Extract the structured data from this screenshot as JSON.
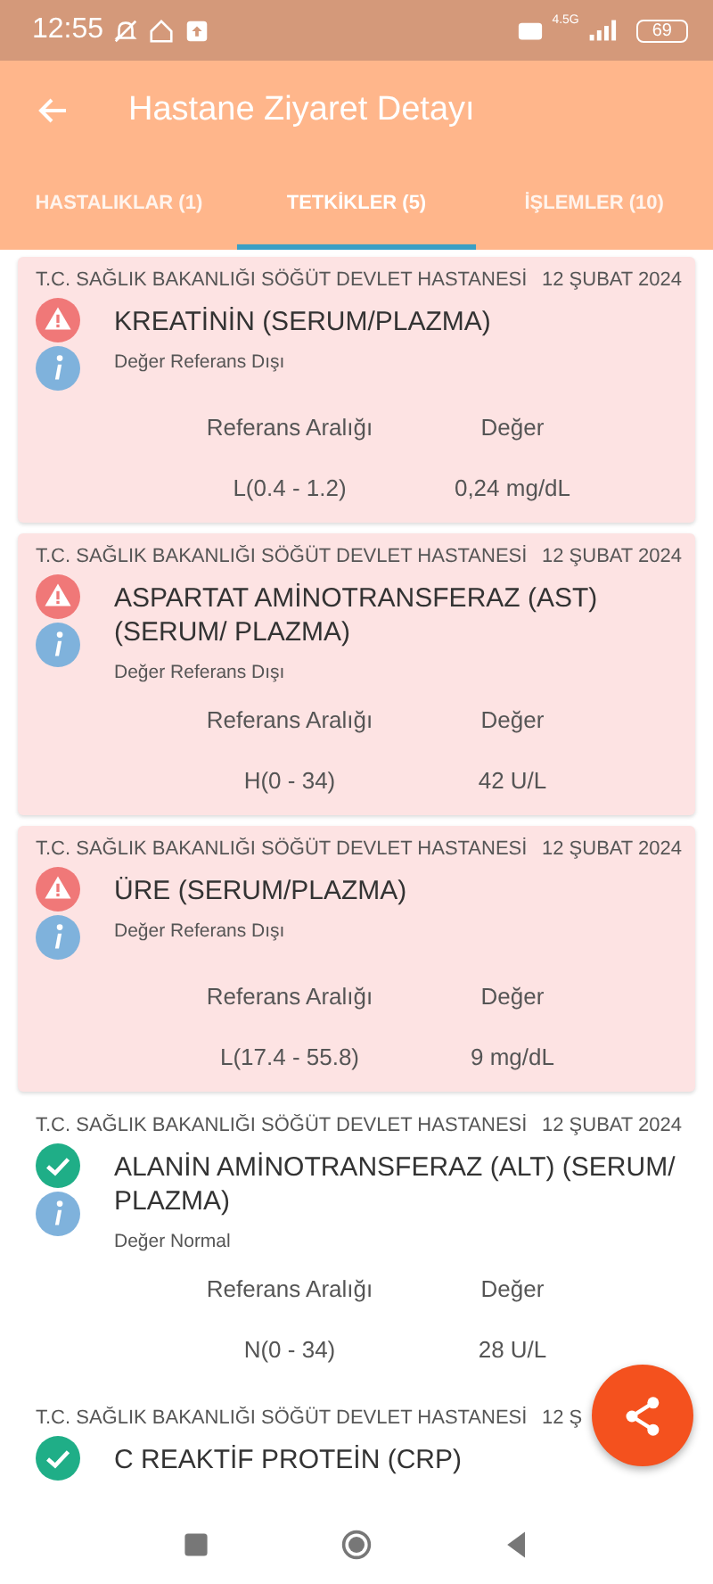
{
  "status_bar": {
    "time": "12:55",
    "network": "4.5G",
    "battery": "69"
  },
  "app_bar": {
    "title": "Hastane Ziyaret Detayı"
  },
  "tabs": [
    {
      "label": "HASTALIKLAR (1)",
      "selected": false
    },
    {
      "label": "TETKİKLER (5)",
      "selected": true
    },
    {
      "label": "İŞLEMLER (10)",
      "selected": false
    }
  ],
  "tests": [
    {
      "kind": "abnormal",
      "hospital": "T.C. SAĞLIK BAKANLIĞI SÖĞÜT DEVLET HASTANESİ",
      "date": "12 ŞUBAT 2024",
      "name": "KREATİNİN (SERUM/PLAZMA)",
      "status_text": "Değer Referans Dışı",
      "range_label": "Referans Aralığı",
      "value_label": "Değer",
      "range": "L(0.4 - 1.2)",
      "value": "0,24 mg/dL"
    },
    {
      "kind": "abnormal",
      "hospital": "T.C. SAĞLIK BAKANLIĞI SÖĞÜT DEVLET HASTANESİ",
      "date": "12 ŞUBAT 2024",
      "name": "ASPARTAT AMİNOTRANSFERAZ (AST) (SERUM/ PLAZMA)",
      "status_text": "Değer Referans Dışı",
      "range_label": "Referans Aralığı",
      "value_label": "Değer",
      "range": "H(0 - 34)",
      "value": "42 U/L"
    },
    {
      "kind": "abnormal",
      "hospital": "T.C. SAĞLIK BAKANLIĞI SÖĞÜT DEVLET HASTANESİ",
      "date": "12 ŞUBAT 2024",
      "name": "ÜRE (SERUM/PLAZMA)",
      "status_text": "Değer Referans Dışı",
      "range_label": "Referans Aralığı",
      "value_label": "Değer",
      "range": "L(17.4 - 55.8)",
      "value": "9 mg/dL"
    },
    {
      "kind": "normal",
      "hospital": "T.C. SAĞLIK BAKANLIĞI SÖĞÜT DEVLET HASTANESİ",
      "date": "12 ŞUBAT 2024",
      "name": "ALANİN AMİNOTRANSFERAZ (ALT) (SERUM/ PLAZMA)",
      "status_text": "Değer Normal",
      "range_label": "Referans Aralığı",
      "value_label": "Değer",
      "range": "N(0 - 34)",
      "value": "28 U/L"
    },
    {
      "kind": "normal",
      "hospital": "T.C. SAĞLIK BAKANLIĞI SÖĞÜT DEVLET HASTANESİ",
      "date": "12 Ş",
      "name": "C REAKTİF PROTEİN (CRP)"
    }
  ]
}
